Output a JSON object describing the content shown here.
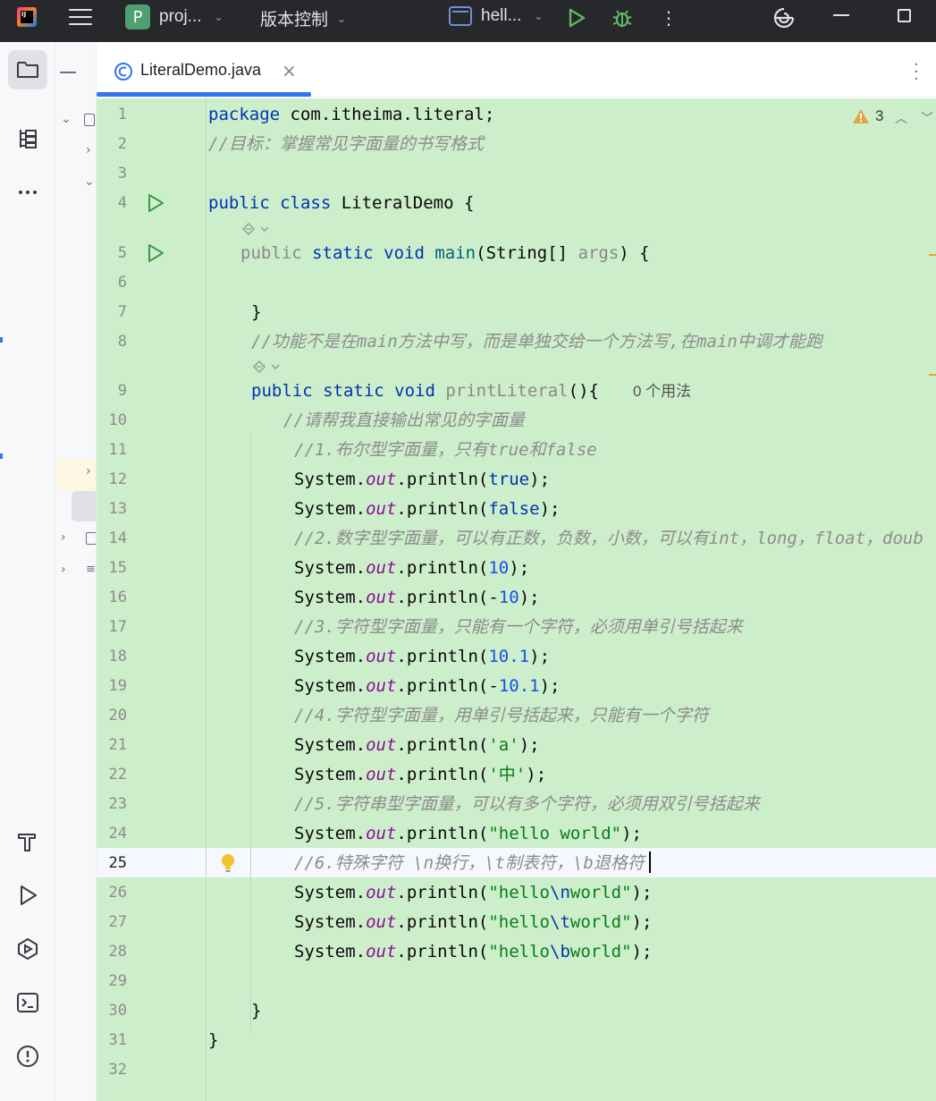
{
  "titlebar": {
    "project_badge": "P",
    "project_name": "proj...",
    "vcs_label": "版本控制",
    "run_config_name": "hell...",
    "icons": [
      "app-logo",
      "menu-icon",
      "run-icon",
      "debug-icon",
      "more-icon",
      "ai-assistant-icon",
      "minimize-icon",
      "maximize-icon"
    ]
  },
  "tab": {
    "filename": "LiteralDemo.java",
    "close": "×"
  },
  "editor": {
    "problems_count": "3",
    "usage_hint": "0 个用法",
    "current_line": 25,
    "line_numbers": [
      "1",
      "2",
      "3",
      "4",
      "5",
      "6",
      "7",
      "8",
      "9",
      "10",
      "11",
      "12",
      "13",
      "14",
      "15",
      "16",
      "17",
      "18",
      "19",
      "20",
      "21",
      "22",
      "23",
      "24",
      "25",
      "26",
      "27",
      "28",
      "29",
      "30",
      "31",
      "32"
    ],
    "lines": {
      "l1_kw": "package",
      "l1_rest": " com.itheima.literal;",
      "l2": "//目标：掌握常见字面量的书写格式",
      "l4_kw": "public class",
      "l4_rest": " LiteralDemo {",
      "l5_mod": "public",
      "l5_kw": " static void",
      "l5_name": " main",
      "l5_open": "(String[] ",
      "l5_param": "args",
      "l5_close": ") {",
      "l7": "}",
      "l8": "//功能不是在main方法中写，而是单独交给一个方法写,在main中调才能跑",
      "l9_kw": "public static void",
      "l9_name": " printLiteral",
      "l9_rest": "(){",
      "l10": "//请帮我直接输出常见的字面量",
      "l11": "//1.布尔型字面量，只有true和false",
      "sys": "System.",
      "out": "out",
      "println": ".println(",
      "close": ");",
      "l12_val": "true",
      "l13_val": "false",
      "l14": "//2.数字型字面量，可以有正数，负数，小数，可以有int，long，float，doub",
      "l15_val": "10",
      "l16_minus": "-",
      "l16_val": "10",
      "l17": "//3.字符型字面量，只能有一个字符，必须用单引号括起来",
      "l18_val": "10.1",
      "l19_minus": "-",
      "l19_val": "10.1",
      "l20": "//4.字符型字面量，用单引号括起来，只能有一个字符",
      "l21_val": "'a'",
      "l22_val": "'中'",
      "l23": "//5.字符串型字面量，可以有多个字符，必须用双引号括起来",
      "l24_val": "\"hello world\"",
      "l25": "//6.特殊字符 \\n换行，\\t制表符，\\b退格符",
      "l26_a": "\"hello",
      "l26_esc": "\\n",
      "l26_b": "world\"",
      "l27_a": "\"hello",
      "l27_esc": "\\t",
      "l27_b": "world\"",
      "l28_a": "\"hello",
      "l28_esc": "\\b",
      "l28_b": "world\"",
      "l30": "}",
      "l31": "}"
    }
  },
  "colors": {
    "editor_bg": "#cdeecb",
    "titlebar_bg": "#27282c",
    "keyword": "#0033b3",
    "string": "#067d17",
    "number": "#1750eb",
    "field": "#871094",
    "comment": "#8c8c8c",
    "accent": "#3574f0"
  }
}
